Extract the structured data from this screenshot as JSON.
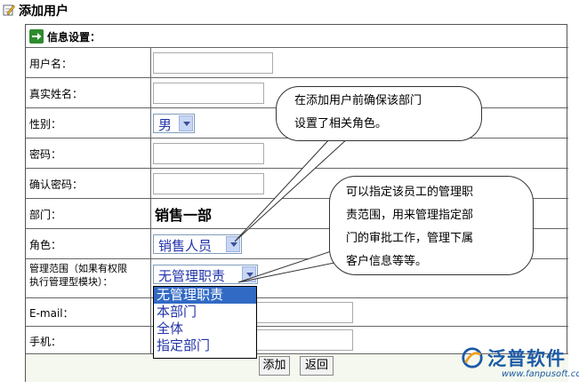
{
  "page": {
    "title": "添加用户"
  },
  "section": {
    "header": "信息设置："
  },
  "fields": {
    "username": {
      "label": "用户名：",
      "value": ""
    },
    "realname": {
      "label": "真实姓名：",
      "value": ""
    },
    "gender": {
      "label": "性别：",
      "selected": "男"
    },
    "password": {
      "label": "密码：",
      "value": ""
    },
    "confirm_password": {
      "label": "确认密码：",
      "value": ""
    },
    "department": {
      "label": "部门：",
      "value": "销售一部"
    },
    "role": {
      "label": "角色：",
      "selected": "销售人员"
    },
    "scope": {
      "label_line1": "管理范围（如果有权限",
      "label_line2": "执行管理型模块）：",
      "selected": "无管理职责",
      "options": [
        "无管理职责",
        "本部门",
        "全体",
        "指定部门"
      ]
    },
    "email": {
      "label": "E-mail：",
      "value": ""
    },
    "phone": {
      "label": "手机：",
      "value": ""
    }
  },
  "buttons": {
    "add": "添加",
    "back": "返回"
  },
  "callouts": {
    "role_note_line1": "在添加用户前确保该部门",
    "role_note_line2": "设置了相关角色。",
    "scope_note_line1": "可以指定该员工的管理职",
    "scope_note_line2": "责范围，用来管理指定部",
    "scope_note_line3": "门的审批工作，管理下属",
    "scope_note_line4": "客户信息等等。"
  },
  "logo": {
    "name": "泛普软件",
    "url": "www.fanpusoft.com"
  },
  "colors": {
    "section_icon": "#2e8b2e",
    "dropdown_selected": "#316ac5",
    "logo": "#1c5aa6"
  }
}
